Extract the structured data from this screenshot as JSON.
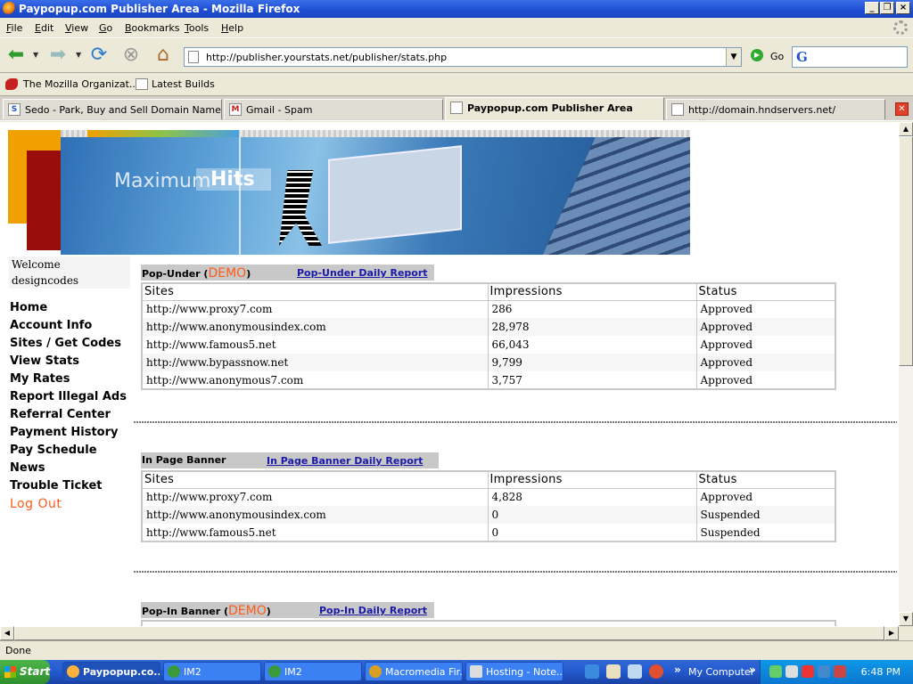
{
  "window": {
    "title": "Paypopup.com Publisher Area - Mozilla Firefox"
  },
  "menu": [
    "File",
    "Edit",
    "View",
    "Go",
    "Bookmarks",
    "Tools",
    "Help"
  ],
  "nav": {
    "url": "http://publisher.yourstats.net/publisher/stats.php",
    "go_label": "Go",
    "search_glyph": "G"
  },
  "bookmarks": [
    "The Mozilla Organizat...",
    "Latest Builds"
  ],
  "tabs": [
    {
      "label": "Sedo - Park, Buy and Sell Domain Names a...",
      "icon": "S"
    },
    {
      "label": "Gmail - Spam",
      "icon": "M"
    },
    {
      "label": "Paypopup.com Publisher Area",
      "icon": ""
    },
    {
      "label": "http://domain.hndservers.net/",
      "icon": ""
    }
  ],
  "banner": {
    "text1": "Maximum",
    "text2": "Hits"
  },
  "welcome": {
    "line1": "Welcome",
    "line2": "designcodes"
  },
  "sidebar": [
    "Home",
    "Account Info",
    "Sites / Get Codes",
    "View Stats",
    "My Rates",
    "Report Illegal Ads",
    "Referral Center",
    "Payment History",
    "Pay Schedule",
    "News",
    "Trouble Ticket"
  ],
  "logout": "Log Out",
  "columns": {
    "sites": "Sites",
    "impressions": "Impressions",
    "status": "Status"
  },
  "popunder": {
    "title": "Pop-Under (",
    "demo": "DEMO",
    "close": ")",
    "report": "Pop-Under Daily Report",
    "rows": [
      [
        "http://www.proxy7.com",
        "286",
        "Approved"
      ],
      [
        "http://www.anonymousindex.com",
        "28,978",
        "Approved"
      ],
      [
        "http://www.famous5.net",
        "66,043",
        "Approved"
      ],
      [
        "http://www.bypassnow.net",
        "9,799",
        "Approved"
      ],
      [
        "http://www.anonymous7.com",
        "3,757",
        "Approved"
      ]
    ]
  },
  "inpage": {
    "title": "In Page Banner",
    "report": "In Page Banner Daily Report",
    "rows": [
      [
        "http://www.proxy7.com",
        "4,828",
        "Approved"
      ],
      [
        "http://www.anonymousindex.com",
        "0",
        "Suspended"
      ],
      [
        "http://www.famous5.net",
        "0",
        "Suspended"
      ]
    ]
  },
  "popin": {
    "title": "Pop-In Banner (",
    "demo": "DEMO",
    "close": ")",
    "report": "Pop-In Daily Report"
  },
  "status": "Done",
  "taskbar": {
    "start": "Start",
    "items": [
      "Paypopup.co...",
      "IM2",
      "IM2",
      "Macromedia Fir...",
      "Hosting - Note..."
    ],
    "my_computer": "My Computer",
    "clock": "6:48 PM"
  }
}
